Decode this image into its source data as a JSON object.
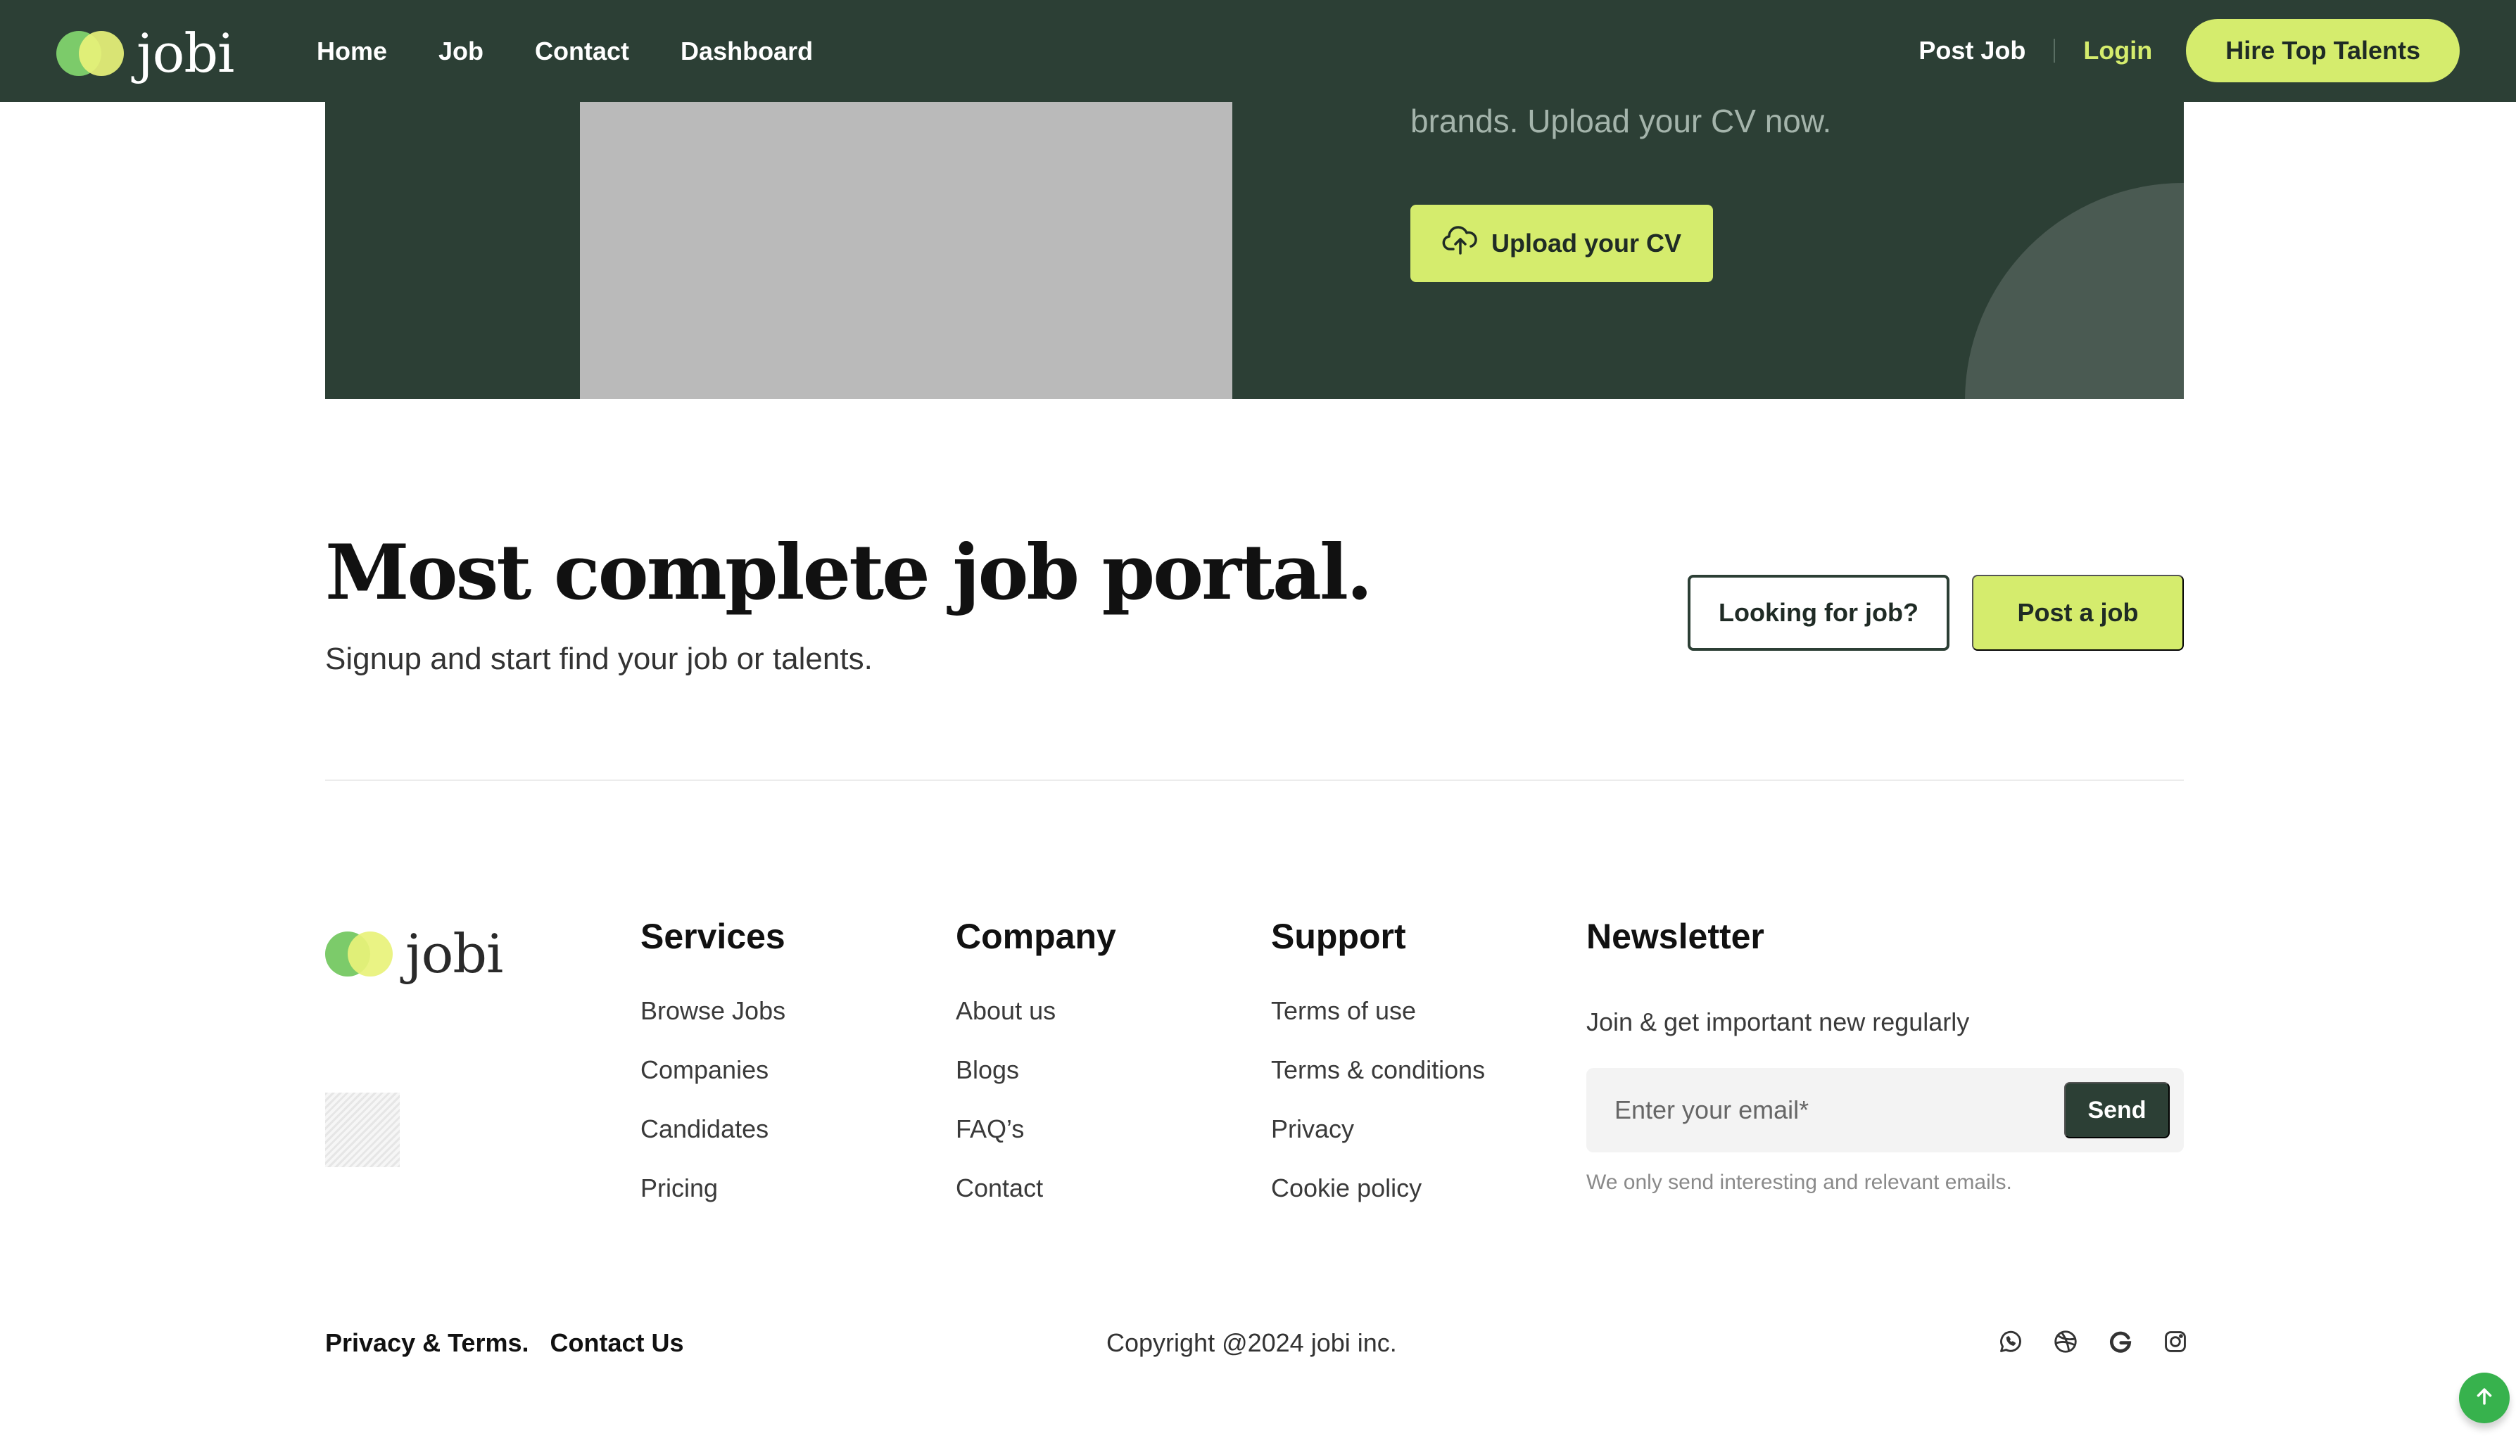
{
  "brand": {
    "name": "jobi"
  },
  "header": {
    "nav": [
      "Home",
      "Job",
      "Contact",
      "Dashboard"
    ],
    "post_job": "Post Job",
    "login": "Login",
    "hire": "Hire Top Talents"
  },
  "banner": {
    "text": "brands. Upload your CV now.",
    "upload_button": "Upload your CV"
  },
  "cta": {
    "title": "Most complete job portal.",
    "subtitle": "Signup and start find your job or talents.",
    "looking_button": "Looking for job?",
    "post_button": "Post a job"
  },
  "footer": {
    "services": {
      "title": "Services",
      "items": [
        "Browse Jobs",
        "Companies",
        "Candidates",
        "Pricing"
      ]
    },
    "company": {
      "title": "Company",
      "items": [
        "About us",
        "Blogs",
        "FAQ’s",
        "Contact"
      ]
    },
    "support": {
      "title": "Support",
      "items": [
        "Terms of use",
        "Terms & conditions",
        "Privacy",
        "Cookie policy"
      ]
    },
    "newsletter": {
      "title": "Newsletter",
      "subtitle": "Join & get important new regularly",
      "placeholder": "Enter your email*",
      "send": "Send",
      "note": "We only send interesting and relevant emails."
    },
    "bottom_links": [
      "Privacy & Terms.",
      "Contact Us"
    ],
    "copyright": "Copyright @2024 jobi inc.",
    "socials": [
      "whatsapp-icon",
      "dribbble-icon",
      "google-icon",
      "instagram-icon"
    ]
  },
  "colors": {
    "dark_green": "#2c3f35",
    "lime": "#d5ec6d",
    "scroll_green": "#37b24d"
  }
}
